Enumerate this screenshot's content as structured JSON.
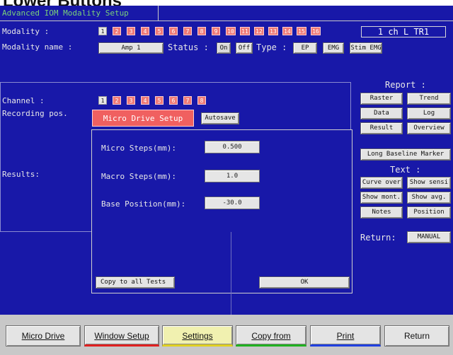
{
  "top_heading": "Lower Buttons",
  "window_title": "Advanced IOM Modality Setup",
  "modality": {
    "label": "Modality :",
    "numbers": [
      "1",
      "2",
      "3",
      "4",
      "5",
      "6",
      "7",
      "8",
      "9",
      "10",
      "11",
      "12",
      "13",
      "14",
      "15",
      "16"
    ],
    "selected": "1",
    "channel_display": "1 ch L TR1"
  },
  "modality_name": {
    "label": "Modality name :",
    "value": "Amp 1",
    "status_label": "Status :",
    "status_on": "On",
    "status_off": "Off",
    "type_label": "Type :",
    "type_options": [
      "EP",
      "EMG",
      "Stim EMG"
    ]
  },
  "channel": {
    "label": "Channel :",
    "numbers": [
      "1",
      "2",
      "3",
      "4",
      "5",
      "6",
      "7",
      "8"
    ],
    "selected": "1"
  },
  "recording_pos": {
    "label": "Recording pos."
  },
  "results": {
    "label": "Results:"
  },
  "dialog": {
    "tab_label": "Micro Drive Setup",
    "autosave_label": "Autosave",
    "micro_steps_label": "Micro Steps(mm):",
    "micro_steps_value": "0.500",
    "macro_steps_label": "Macro Steps(mm):",
    "macro_steps_value": "1.0",
    "base_position_label": "Base Position(mm):",
    "base_position_value": "-30.0",
    "copy_all_label": "Copy to all Tests",
    "ok_label": "OK"
  },
  "report": {
    "heading": "Report :",
    "buttons": [
      "Raster",
      "Trend",
      "Data",
      "Log",
      "Result",
      "Overview"
    ],
    "long_baseline": "Long Baseline Marker",
    "text_heading": "Text :",
    "text_buttons": [
      "Curve over",
      "Show sensi",
      "Show mont.",
      "Show avg.",
      "Notes",
      "Position"
    ],
    "return_label": "Return:",
    "return_value": "MANUAL"
  },
  "bottom_buttons": [
    {
      "label": "Micro Drive",
      "accent": "#e4e4e4"
    },
    {
      "label": "Window Setup",
      "accent": "#e02020"
    },
    {
      "label": "Settings",
      "accent": "#e0d020"
    },
    {
      "label": "Copy from",
      "accent": "#20b020"
    },
    {
      "label": "Print",
      "accent": "#2040e0"
    },
    {
      "label": "Return",
      "accent": "#e4e4e4"
    }
  ],
  "colors": {
    "background": "#1818a8",
    "accent_red": "#ef7a77",
    "title_green": "#7ad07a",
    "button_grey": "#e4e4e4"
  }
}
